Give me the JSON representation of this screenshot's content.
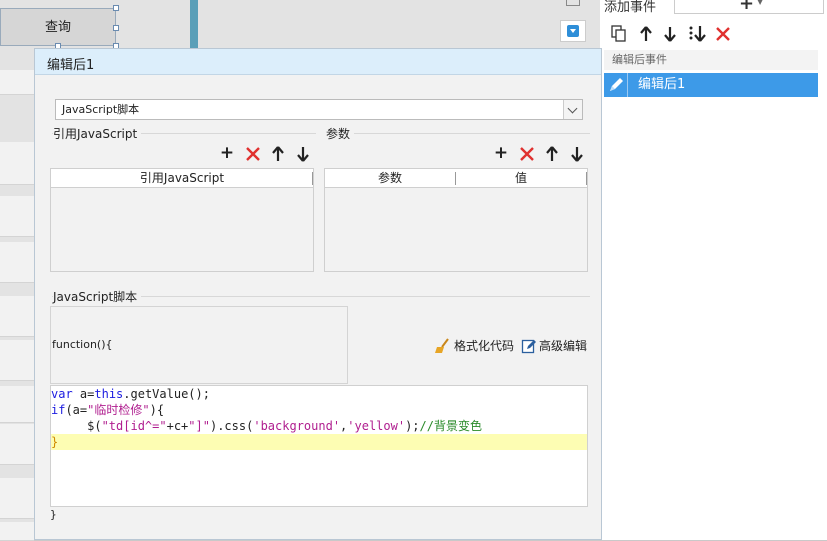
{
  "background": {
    "query_button_label": "查询"
  },
  "right_panel": {
    "title": "添加事件",
    "section_label": "编辑后事件",
    "selected_event_label": "编辑后1"
  },
  "dialog": {
    "title": "编辑后1",
    "script_type": "JavaScript脚本",
    "ref_js_group_label": "引用JavaScript",
    "ref_js_column": "引用JavaScript",
    "params_group_label": "参数",
    "params_columns": [
      "参数",
      "值"
    ],
    "script_group_label": "JavaScript脚本",
    "function_header": "function(){",
    "format_code_label": "格式化代码",
    "advanced_edit_label": "高级编辑",
    "code_lines": [
      "var a=this.getValue();",
      "if(a=\"临时检修\"){",
      "     $(\"td[id^=\"+c+\"]\").css('background','yellow');//背景变色",
      "}"
    ],
    "function_footer": "}"
  }
}
